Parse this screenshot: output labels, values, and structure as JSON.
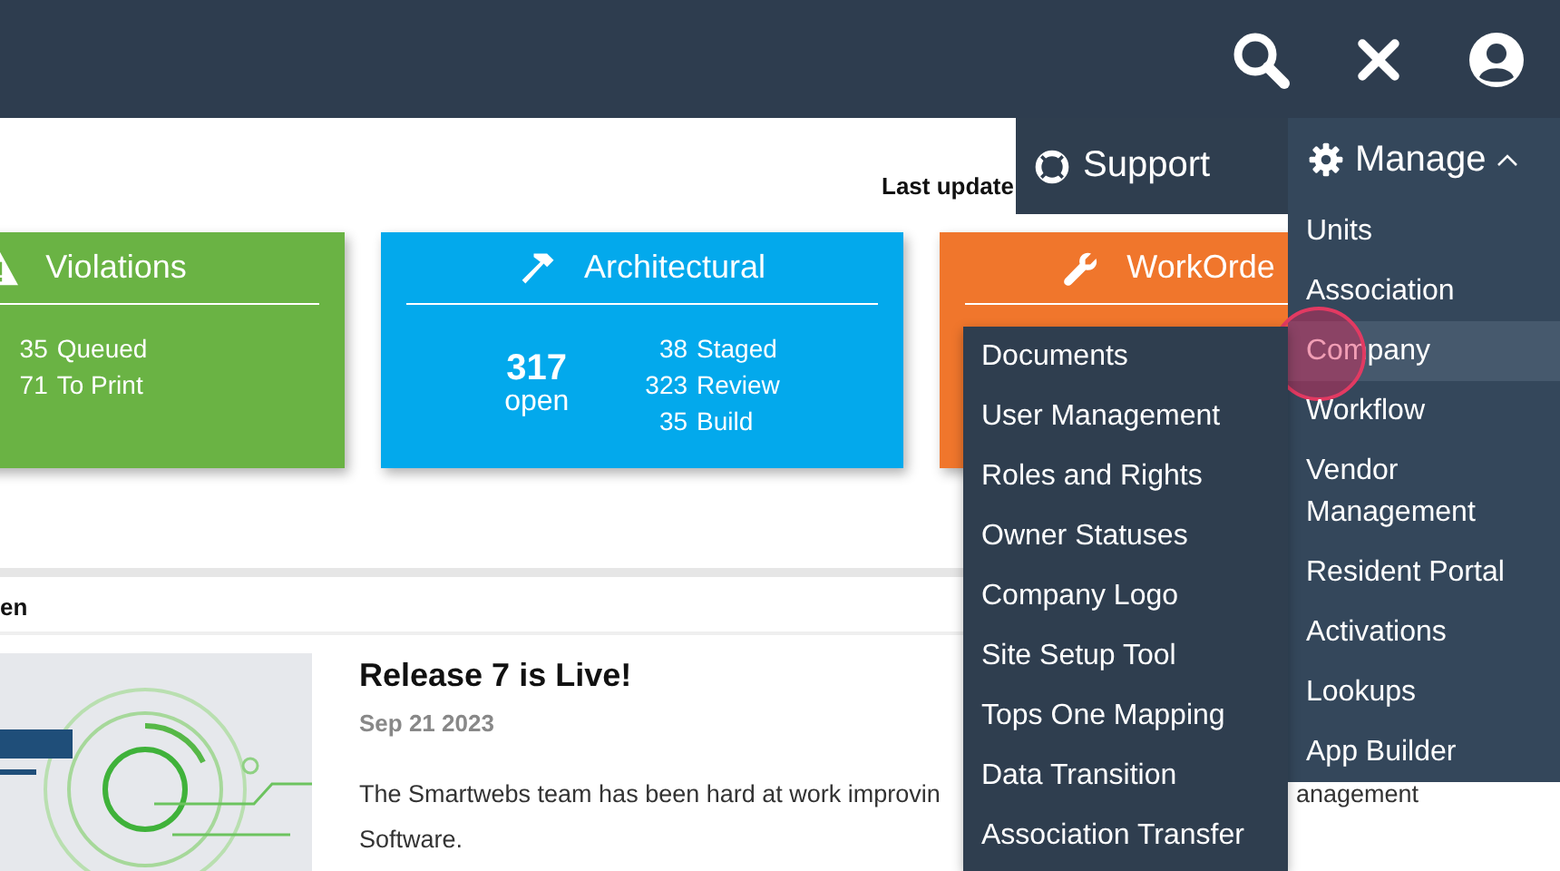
{
  "nav": {
    "support": {
      "label": "Support"
    },
    "manage": {
      "label": "Manage",
      "expanded": true,
      "items": [
        {
          "label": "Units",
          "selected": false
        },
        {
          "label": "Association",
          "selected": false
        },
        {
          "label": "Company",
          "selected": true
        },
        {
          "label": "Workflow",
          "selected": false
        },
        {
          "label": "Vendor Management",
          "selected": false
        },
        {
          "label": "Resident Portal",
          "selected": false
        },
        {
          "label": "Activations",
          "selected": false
        },
        {
          "label": "Lookups",
          "selected": false
        },
        {
          "label": "App Builder",
          "selected": false
        }
      ]
    }
  },
  "submenu": {
    "items": [
      "Documents",
      "User Management",
      "Roles and Rights",
      "Owner Statuses",
      "Company Logo",
      "Site Setup Tool",
      "Tops One Mapping",
      "Data Transition",
      "Association Transfer"
    ]
  },
  "last_updated": "Last update",
  "cards": [
    {
      "kind": "violations",
      "title": "Violations",
      "color": "#6ab344",
      "stats": [
        {
          "count": "35",
          "label": "Queued"
        },
        {
          "count": "71",
          "label": "To Print"
        }
      ]
    },
    {
      "kind": "architectural",
      "title": "Architectural",
      "color": "#03a9ec",
      "open": {
        "count": "317",
        "label": "open"
      },
      "stats": [
        {
          "count": "38",
          "label": "Staged"
        },
        {
          "count": "323",
          "label": "Review"
        },
        {
          "count": "35",
          "label": "Build"
        }
      ]
    },
    {
      "kind": "workorders",
      "title": "WorkOrde",
      "color": "#f0762c"
    }
  ],
  "news": {
    "section_title": "en",
    "items": [
      {
        "kind": "picture",
        "title": "Release 7 is Live!",
        "date": "Sep 21 2023",
        "line_1": "The Smartwebs team has been hard at work improvin",
        "line_1_end": "anagement",
        "line_2": "Software."
      }
    ]
  }
}
